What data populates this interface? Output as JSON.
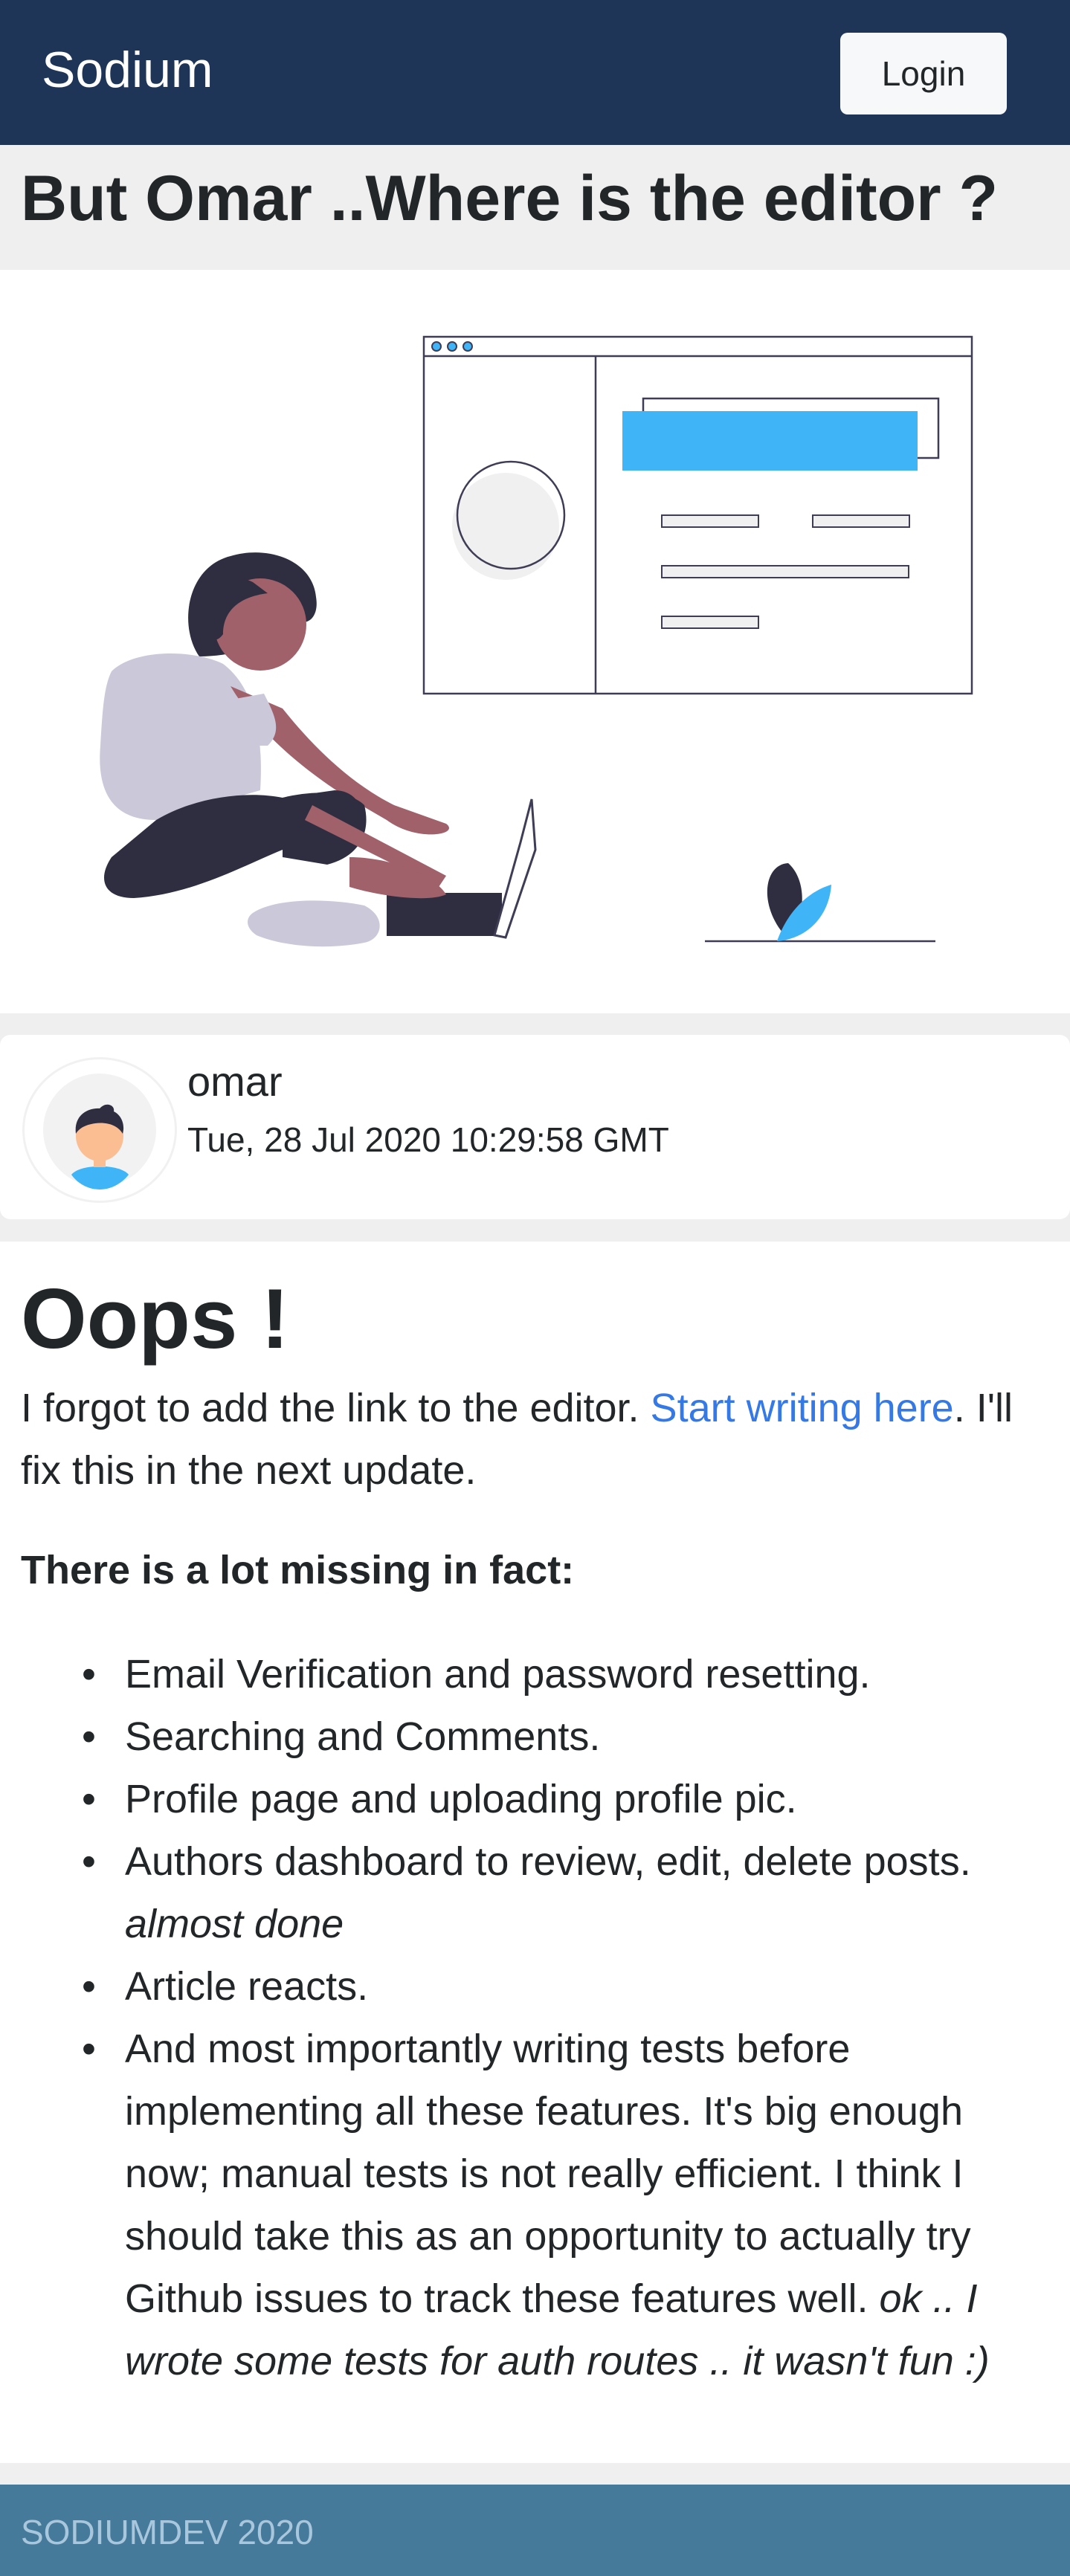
{
  "navbar": {
    "brand": "Sodium",
    "login_label": "Login",
    "background": "#1e3558"
  },
  "post": {
    "title": "But Omar ..Where is the editor ?",
    "hero_illustration": "person-with-laptop-illustration",
    "author": "omar",
    "date": "Tue, 28 Jul 2020 10:29:58 GMT",
    "avatar_icon": "avatar-icon"
  },
  "article": {
    "heading": "Oops !",
    "intro_before": "I forgot to add the link to the editor. ",
    "intro_link": "Start writing here",
    "intro_after": ". I'll fix this in the next update.",
    "missing_heading": "There is a lot missing in fact:",
    "items": [
      {
        "text": "Email Verification and password resetting.",
        "note": ""
      },
      {
        "text": "Searching and Comments.",
        "note": ""
      },
      {
        "text": "Profile page and uploading profile pic.",
        "note": ""
      },
      {
        "text": "Authors dashboard to review, edit, delete posts. ",
        "note": "almost done"
      },
      {
        "text": "Article reacts.",
        "note": ""
      },
      {
        "text": "And most importantly writing tests before implementing all these features. It's big enough now; manual tests is not really efficient. I think I should take this as an opportunity to actually try Github issues to track these features well. ",
        "note": "ok .. I wrote some tests for auth routes .. it wasn't fun :)"
      }
    ],
    "link_color": "#3579e6"
  },
  "footer": {
    "text": "SODIUMDEV 2020",
    "background": "#467a9b"
  }
}
